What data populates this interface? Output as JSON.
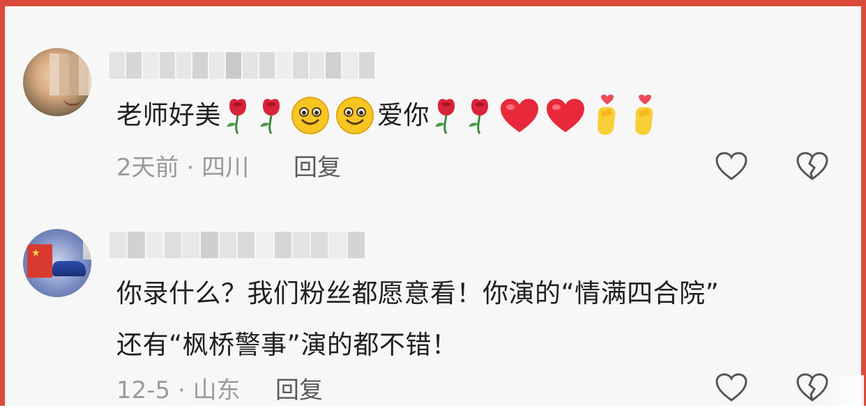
{
  "comments": [
    {
      "text": "老师好美",
      "text_after_smiles": "爱你",
      "time": "2天前",
      "separator": "·",
      "location": "四川",
      "reply_label": "回复"
    },
    {
      "line1": "你录什么？我们粉丝都愿意看！你演的“情满四合院”",
      "line2": "还有“枫桥警事”演的都不错！",
      "time": "12-5",
      "separator": "·",
      "location": "山东",
      "reply_label": "回复"
    }
  ],
  "icons": {
    "like": "heart-outline-icon",
    "dislike": "broken-heart-icon",
    "rose": "rose-emoji",
    "smile": "smile-emoji",
    "heart": "red-heart-emoji",
    "finger_heart": "finger-heart-emoji"
  },
  "colors": {
    "frame": "#d94a3a",
    "text": "#1f1f1f",
    "meta": "#9a9a9a",
    "reply": "#5a5a5a",
    "heart": "#e8293b"
  }
}
